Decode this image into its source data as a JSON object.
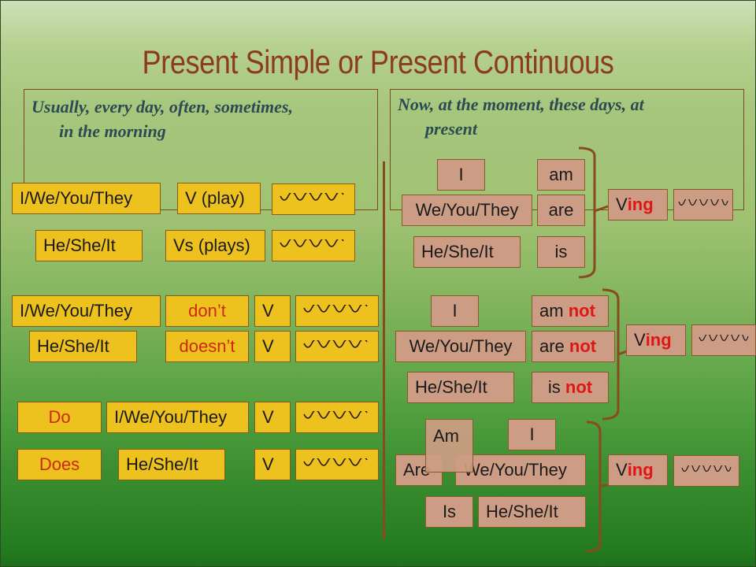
{
  "title": "Present Simple or Present Continuous",
  "present_simple": {
    "signal_words_line1": "Usually, every day, often, sometimes,",
    "signal_words_line2": "in the morning",
    "affirmative": [
      {
        "subject": "I/We/You/They",
        "verb": "V (play)",
        "rest_icon": "wavy-line-icon"
      },
      {
        "subject": "He/She/It",
        "verb": "Vs (plays)",
        "rest_icon": "wavy-line-icon"
      }
    ],
    "negative": [
      {
        "subject": "I/We/You/They",
        "auxiliary": "don’t",
        "verb": "V",
        "rest_icon": "wavy-line-icon"
      },
      {
        "subject": "He/She/It",
        "auxiliary": "doesn’t",
        "verb": "V",
        "rest_icon": "wavy-line-icon"
      }
    ],
    "question": [
      {
        "auxiliary": "Do",
        "subject": "I/We/You/They",
        "verb": "V",
        "rest_icon": "wavy-line-icon"
      },
      {
        "auxiliary": "Does",
        "subject": "He/She/It",
        "verb": "V",
        "rest_icon": "wavy-line-icon"
      }
    ]
  },
  "present_continuous": {
    "signal_words_line1": "Now, at the moment, these days, at",
    "signal_words_line2": "present",
    "affirmative": {
      "rows": [
        {
          "subject": "I",
          "be": "am"
        },
        {
          "subject": "We/You/They",
          "be": "are"
        },
        {
          "subject": "He/She/It",
          "be": "is"
        }
      ],
      "verb_base": "V",
      "verb_suffix": "ing",
      "rest_icon": "wavy-line-icon"
    },
    "negative": {
      "rows": [
        {
          "subject": "I",
          "be": "am",
          "neg": "not"
        },
        {
          "subject": "We/You/They",
          "be": "are",
          "neg": "not"
        },
        {
          "subject": "He/She/It",
          "be": "is",
          "neg": "not"
        }
      ],
      "verb_base": "V",
      "verb_suffix": "ing",
      "rest_icon": "wavy-line-icon"
    },
    "question": {
      "rows": [
        {
          "be": "Am",
          "subject": "I"
        },
        {
          "be": "Are",
          "subject": "We/You/They"
        },
        {
          "be": "Is",
          "subject": "He/She/It"
        }
      ],
      "verb_base": "V",
      "verb_suffix": "ing",
      "rest_icon": "wavy-line-icon"
    }
  },
  "colors": {
    "title": "#8c3b22",
    "signal_words": "#2c4a52",
    "simple_box": "#eec21e",
    "continuous_box": "#cc9d84",
    "accent_red": "#e01616",
    "lines": "#8a4a20"
  }
}
